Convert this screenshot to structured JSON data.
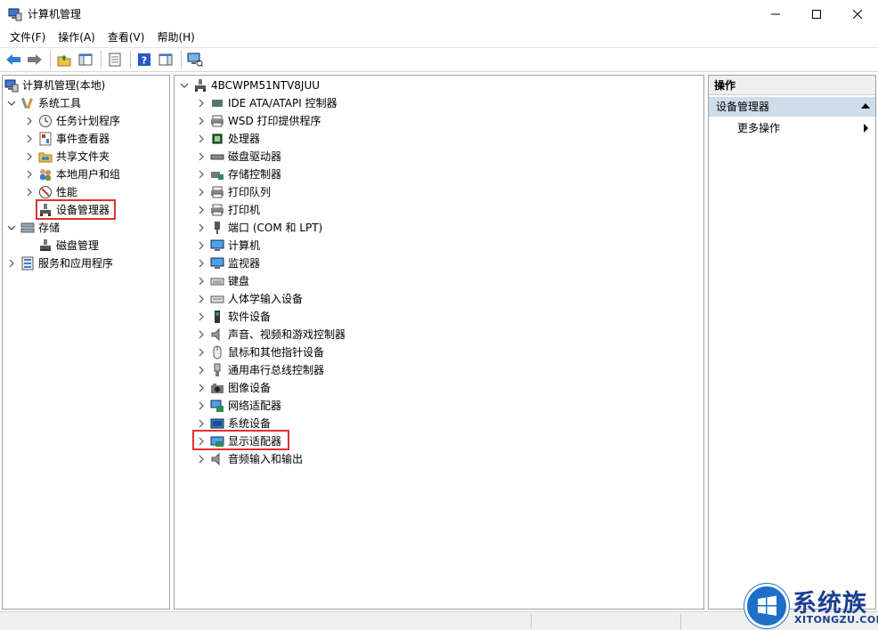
{
  "window": {
    "title": "计算机管理"
  },
  "menu": [
    "文件(F)",
    "操作(A)",
    "查看(V)",
    "帮助(H)"
  ],
  "left_tree": {
    "root": "计算机管理(本地)",
    "system_tools": "系统工具",
    "items": [
      "任务计划程序",
      "事件查看器",
      "共享文件夹",
      "本地用户和组",
      "性能",
      "设备管理器"
    ],
    "storage": "存储",
    "disk_mgmt": "磁盘管理",
    "services": "服务和应用程序"
  },
  "device_tree": {
    "computer_name": "4BCWPM51NTV8JUU",
    "categories": [
      "IDE ATA/ATAPI 控制器",
      "WSD 打印提供程序",
      "处理器",
      "磁盘驱动器",
      "存储控制器",
      "打印队列",
      "打印机",
      "端口 (COM 和 LPT)",
      "计算机",
      "监视器",
      "键盘",
      "人体学输入设备",
      "软件设备",
      "声音、视频和游戏控制器",
      "鼠标和其他指针设备",
      "通用串行总线控制器",
      "图像设备",
      "网络适配器",
      "系统设备",
      "显示适配器",
      "音频输入和输出"
    ]
  },
  "actions": {
    "header": "操作",
    "section": "设备管理器",
    "more": "更多操作"
  },
  "watermark": {
    "title": "系统族",
    "subtitle": "XITONGZU.COM"
  },
  "colors": {
    "highlight": "#e0302f",
    "section_bg": "#cfdcea",
    "watermark_blue": "#1e6fc7"
  }
}
